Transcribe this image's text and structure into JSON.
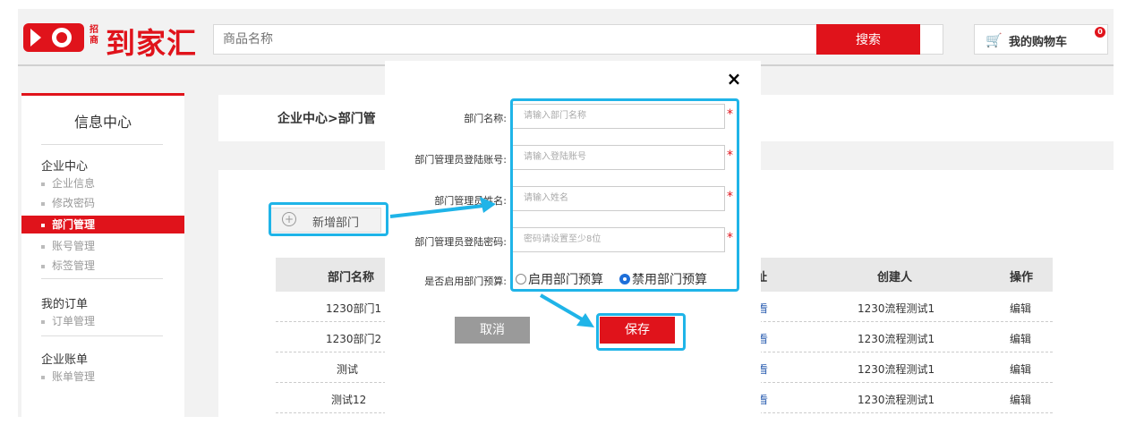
{
  "header": {
    "logo_small": "招商",
    "logo_text": "到家汇",
    "search_placeholder": "商品名称",
    "search_button": "搜索",
    "cart_label": "我的购物车",
    "cart_count": "0"
  },
  "sidebar": {
    "title": "信息中心",
    "groups": [
      {
        "label": "企业中心",
        "items": [
          "企业信息",
          "修改密码",
          "部门管理",
          "账号管理",
          "标签管理"
        ]
      },
      {
        "label": "我的订单",
        "items": [
          "订单管理"
        ]
      },
      {
        "label": "企业账单",
        "items": [
          "账单管理"
        ]
      }
    ],
    "active_item": "部门管理"
  },
  "main": {
    "breadcrumb": "企业中心>部门管",
    "add_button": "新增部门",
    "columns": [
      "部门名称",
      "址",
      "创建人",
      "操作"
    ],
    "rows": [
      {
        "name": "1230部门1",
        "link": "看",
        "creator": "1230流程测试1",
        "action": "编辑"
      },
      {
        "name": "1230部门2",
        "link": "看",
        "creator": "1230流程测试1",
        "action": "编辑"
      },
      {
        "name": "测试",
        "link": "看",
        "creator": "1230流程测试1",
        "action": "编辑"
      },
      {
        "name": "测试12",
        "link": "看",
        "creator": "1230流程测试1",
        "action": "编辑"
      }
    ]
  },
  "modal": {
    "close": "×",
    "fields": [
      {
        "label": "部门名称:",
        "placeholder": "请输入部门名称"
      },
      {
        "label": "部门管理员登陆账号:",
        "placeholder": "请输入登陆账号"
      },
      {
        "label": "部门管理员姓名:",
        "placeholder": "请输入姓名"
      },
      {
        "label": "部门管理员登陆密码:",
        "placeholder": "密码请设置至少8位"
      }
    ],
    "required_mark": "*",
    "budget_label": "是否启用部门预算:",
    "budget_options": [
      "启用部门预算",
      "禁用部门预算"
    ],
    "budget_selected": "禁用部门预算",
    "cancel_button": "取消",
    "save_button": "保存"
  },
  "colors": {
    "brand": "#e0131b",
    "highlight": "#1fb4e8",
    "radio": "#1e6fd9"
  }
}
